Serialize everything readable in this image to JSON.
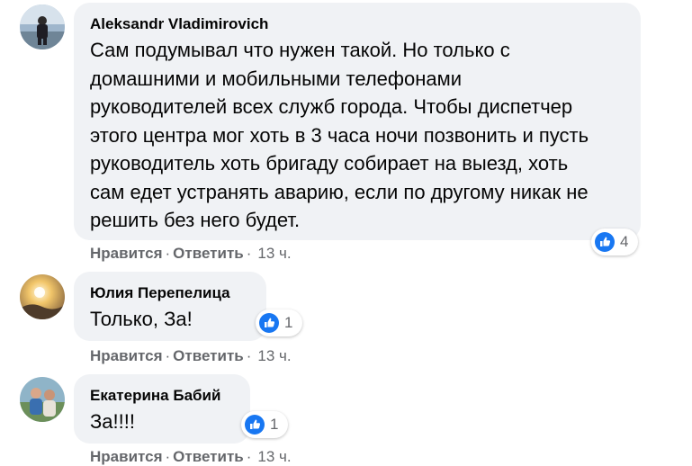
{
  "comments": [
    {
      "author": "Aleksandr Vladimirovich",
      "text": "Сам подумывал что нужен такой. Но только с\nдомашними и мобильными телефонами\nруководителей всех служб города. Чтобы диспетчер\nэтого центра мог хоть в 3 часа ночи позвонить и пусть\nруководитель хоть бригаду собирает на выезд, хоть\nсам едет устранять аварию, если по другому никак не\nрешить без него будет.",
      "like_label": "Нравится",
      "reply_label": "Ответить",
      "time": "13 ч.",
      "reaction_count": "4"
    },
    {
      "author": "Юлия Перепелица",
      "text": "Только, За!",
      "like_label": "Нравится",
      "reply_label": "Ответить",
      "time": "13 ч.",
      "reaction_count": "1"
    },
    {
      "author": "Екатерина Бабий",
      "text": "За!!!!",
      "like_label": "Нравится",
      "reply_label": "Ответить",
      "time": "13 ч.",
      "reaction_count": "1"
    }
  ],
  "separator": "·",
  "colors": {
    "bubble": "#f0f2f5",
    "like_blue": "#1877f2",
    "secondary_text": "#65676b"
  }
}
